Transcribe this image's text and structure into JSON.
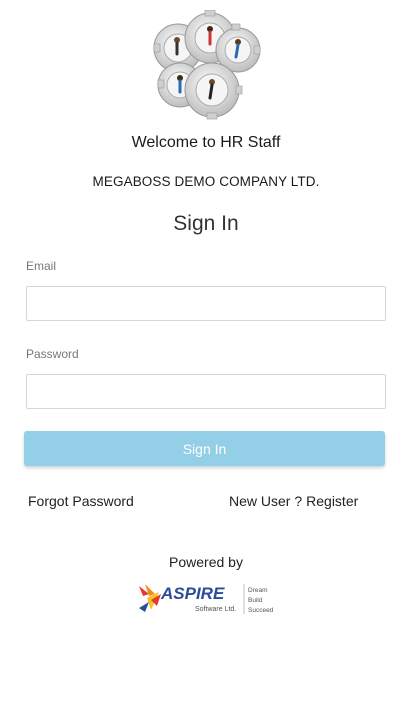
{
  "header": {
    "welcome": "Welcome to HR Staff",
    "company": "MEGABOSS DEMO COMPANY LTD.",
    "icon": "gears-with-people-icon"
  },
  "form": {
    "title": "Sign In",
    "email_label": "Email",
    "email_value": "",
    "password_label": "Password",
    "password_value": "",
    "submit_label": "Sign In",
    "submit_color": "#93cfe6"
  },
  "links": {
    "forgot": "Forgot Password",
    "new_user": "New User ?",
    "register": "Register"
  },
  "footer": {
    "powered_by": "Powered by",
    "brand": "ASPIRE",
    "brand_sub": "Software Ltd.",
    "tagline": [
      "Dream",
      "Build",
      "Succeed"
    ],
    "brand_color": "#2b4c9b"
  }
}
